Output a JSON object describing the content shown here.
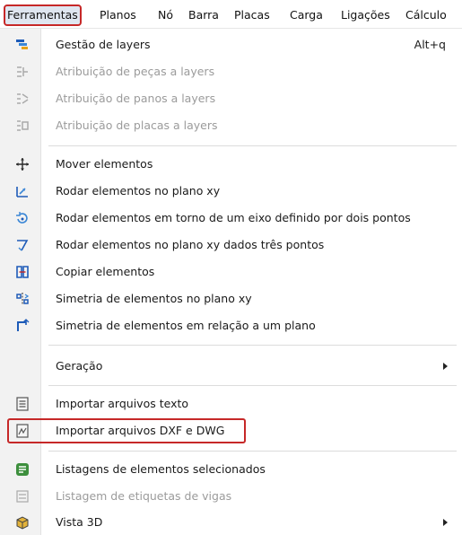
{
  "menubar": {
    "items": [
      {
        "label": "Ferramentas"
      },
      {
        "label": "Planos"
      },
      {
        "label": "Nó"
      },
      {
        "label": "Barra"
      },
      {
        "label": "Placas"
      },
      {
        "label": "Carga"
      },
      {
        "label": "Ligações"
      },
      {
        "label": "Cálculo"
      }
    ]
  },
  "menu": {
    "items": [
      {
        "label": "Gestão de layers",
        "shortcut": "Alt+q",
        "icon": "layers-icon",
        "enabled": true
      },
      {
        "label": "Atribuição de peças a layers",
        "icon": "assign-parts-icon",
        "enabled": false
      },
      {
        "label": "Atribuição de panos a layers",
        "icon": "assign-panes-icon",
        "enabled": false
      },
      {
        "label": "Atribuição de placas a layers",
        "icon": "assign-plates-icon",
        "enabled": false
      },
      {
        "label": "Mover elementos",
        "icon": "move-icon",
        "enabled": true
      },
      {
        "label": "Rodar elementos no plano xy",
        "icon": "rotate-xy-icon",
        "enabled": true
      },
      {
        "label": "Rodar elementos em torno de um eixo definido por dois pontos",
        "icon": "rotate-axis-icon",
        "enabled": true
      },
      {
        "label": "Rodar elementos no plano xy dados três pontos",
        "icon": "rotate-three-points-icon",
        "enabled": true
      },
      {
        "label": "Copiar elementos",
        "icon": "copy-icon",
        "enabled": true
      },
      {
        "label": "Simetria de elementos no plano xy",
        "icon": "mirror-xy-icon",
        "enabled": true
      },
      {
        "label": "Simetria de elementos em relação a um plano",
        "icon": "mirror-plane-icon",
        "enabled": true
      },
      {
        "label": "Geração",
        "submenu": true,
        "enabled": true
      },
      {
        "label": "Importar arquivos texto",
        "icon": "import-text-icon",
        "enabled": true
      },
      {
        "label": "Importar arquivos DXF e DWG",
        "icon": "import-dxf-icon",
        "enabled": true
      },
      {
        "label": "Listagens de elementos selecionados",
        "icon": "listing-icon",
        "enabled": true
      },
      {
        "label": "Listagem de etiquetas de vigas",
        "icon": "beam-labels-icon",
        "enabled": false
      },
      {
        "label": "Vista 3D",
        "submenu": true,
        "icon": "view-3d-icon",
        "enabled": true
      }
    ]
  },
  "colors": {
    "highlight": "#c62828",
    "accent_blue": "#1e5bb8",
    "disabled_text": "#9b9b9b"
  }
}
